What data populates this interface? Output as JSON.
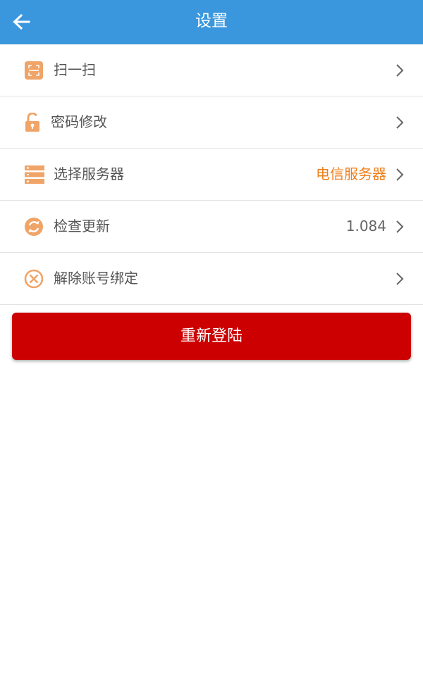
{
  "header": {
    "title": "设置",
    "back_icon": "arrow-left-icon"
  },
  "settings": {
    "items": [
      {
        "label": "扫一扫",
        "value": "",
        "icon": "scan-icon"
      },
      {
        "label": "密码修改",
        "value": "",
        "icon": "unlock-icon"
      },
      {
        "label": "选择服务器",
        "value": "电信服务器",
        "icon": "server-icon"
      },
      {
        "label": "检查更新",
        "value": "1.084",
        "icon": "refresh-icon"
      },
      {
        "label": "解除账号绑定",
        "value": "",
        "icon": "unbind-icon"
      }
    ]
  },
  "actions": {
    "relogin_label": "重新登陆"
  },
  "colors": {
    "header_bg": "#3a97dd",
    "icon_orange": "#f0a467",
    "accent_orange": "#ef7f1a",
    "relogin_red": "#cc0001"
  }
}
